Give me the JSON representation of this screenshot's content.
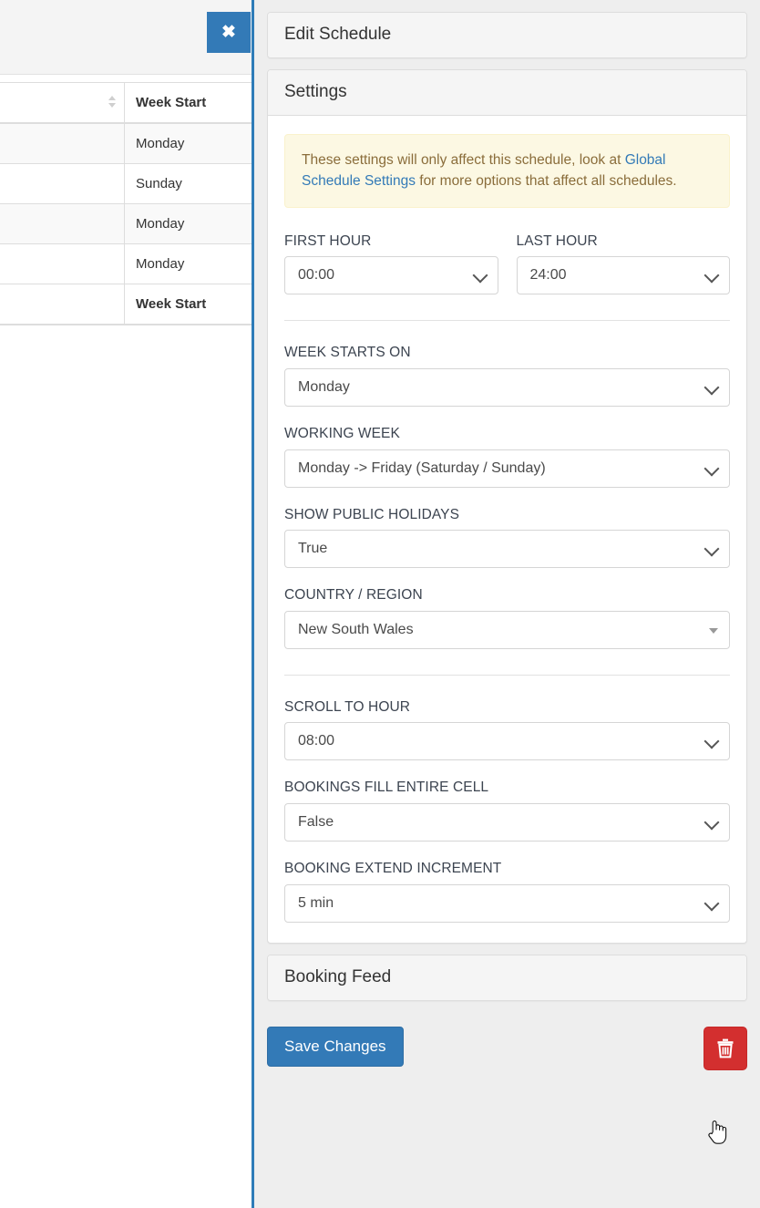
{
  "background": {
    "table": {
      "columns": [
        "",
        "Week Start"
      ],
      "sortable_column_index": 0,
      "rows": [
        {
          "name": "",
          "week_start": "Monday"
        },
        {
          "name": "",
          "week_start": "Sunday"
        },
        {
          "name": "",
          "week_start": "Monday"
        },
        {
          "name": "",
          "week_start": "Monday"
        }
      ],
      "footer": [
        "",
        "Week Start"
      ]
    }
  },
  "close_button": {
    "label": "✖",
    "icon": "close-icon"
  },
  "modal": {
    "title": "Edit Schedule",
    "panels": {
      "settings": {
        "heading": "Settings",
        "alert": {
          "text_before_link": "These settings will only affect this schedule, look at ",
          "link_text": "Global Schedule Settings",
          "text_after_link": " for more options that affect all schedules.",
          "background_color": "#fcf8e3",
          "text_color": "#8a6d3b",
          "link_color": "#337ab7"
        },
        "fields": [
          {
            "label": "FIRST HOUR",
            "value": "00:00",
            "caret": "chevron-down-icon"
          },
          {
            "label": "LAST HOUR",
            "value": "24:00",
            "caret": "chevron-down-icon"
          },
          {
            "label": "WEEK STARTS ON",
            "value": "Monday",
            "caret": "chevron-down-icon"
          },
          {
            "label": "WORKING WEEK",
            "value": "Monday -> Friday (Saturday / Sunday)",
            "caret": "chevron-down-icon"
          },
          {
            "label": "SHOW PUBLIC HOLIDAYS",
            "value": "True",
            "caret": "chevron-down-icon"
          },
          {
            "label": "COUNTRY / REGION",
            "value": "New South Wales",
            "caret": "triangle-down-icon"
          },
          {
            "label": "SCROLL TO HOUR",
            "value": "08:00",
            "caret": "chevron-down-icon"
          },
          {
            "label": "BOOKINGS FILL ENTIRE CELL",
            "value": "False",
            "caret": "chevron-down-icon"
          },
          {
            "label": "BOOKING EXTEND INCREMENT",
            "value": "5 min",
            "caret": "chevron-down-icon"
          }
        ]
      },
      "booking_feed": {
        "heading": "Booking Feed"
      }
    },
    "footer": {
      "save_label": "Save Changes",
      "delete_icon": "trash-icon",
      "save_color": "#337ab7",
      "delete_color": "#d32f2f"
    },
    "accent_border_color": "#2e7cb8"
  }
}
